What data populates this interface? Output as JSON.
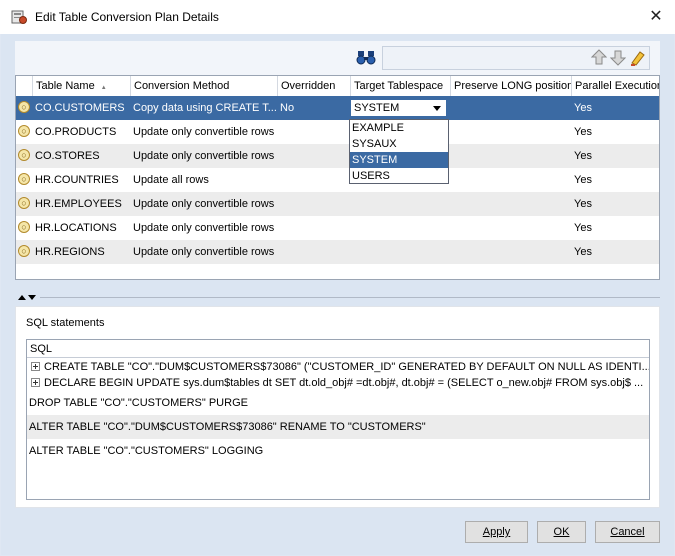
{
  "window": {
    "title": "Edit Table Conversion Plan Details",
    "close_glyph": "✕"
  },
  "toolbar": {
    "find_value": ""
  },
  "grid": {
    "columns": [
      "Table Name",
      "Conversion Method",
      "Overridden",
      "Target Tablespace",
      "Preserve LONG position",
      "Parallel Execution"
    ],
    "sort_glyph": "▲",
    "rows": [
      {
        "table": "CO.CUSTOMERS",
        "method": "Copy data using CREATE T...",
        "overridden": "No",
        "tablespace": "SYSTEM",
        "preserve": "",
        "parallel": "Yes"
      },
      {
        "table": "CO.PRODUCTS",
        "method": "Update only convertible rows",
        "overridden": "",
        "tablespace": "",
        "preserve": "",
        "parallel": "Yes"
      },
      {
        "table": "CO.STORES",
        "method": "Update only convertible rows",
        "overridden": "",
        "tablespace": "",
        "preserve": "",
        "parallel": "Yes"
      },
      {
        "table": "HR.COUNTRIES",
        "method": "Update all rows",
        "overridden": "",
        "tablespace": "",
        "preserve": "",
        "parallel": "Yes"
      },
      {
        "table": "HR.EMPLOYEES",
        "method": "Update only convertible rows",
        "overridden": "",
        "tablespace": "",
        "preserve": "",
        "parallel": "Yes"
      },
      {
        "table": "HR.LOCATIONS",
        "method": "Update only convertible rows",
        "overridden": "",
        "tablespace": "",
        "preserve": "",
        "parallel": "Yes"
      },
      {
        "table": "HR.REGIONS",
        "method": "Update only convertible rows",
        "overridden": "",
        "tablespace": "",
        "preserve": "",
        "parallel": "Yes"
      }
    ],
    "tablespace_options": [
      "EXAMPLE",
      "SYSAUX",
      "SYSTEM",
      "USERS"
    ],
    "selected_tablespace": "SYSTEM"
  },
  "sql": {
    "label": "SQL statements",
    "header": "SQL",
    "statements": [
      "CREATE TABLE \"CO\".\"DUM$CUSTOMERS$73086\"    (\"CUSTOMER_ID\"  GENERATED BY DEFAULT ON NULL AS IDENTI...",
      "DECLARE BEGIN    UPDATE sys.dum$tables dt SET dt.old_obj# =dt.obj#, dt.obj# = (SELECT o_new.obj# FROM sys.obj$ ...",
      "DROP TABLE \"CO\".\"CUSTOMERS\" PURGE",
      "ALTER TABLE \"CO\".\"DUM$CUSTOMERS$73086\" RENAME TO \"CUSTOMERS\"",
      "ALTER TABLE \"CO\".\"CUSTOMERS\" LOGGING"
    ]
  },
  "buttons": {
    "apply": "Apply",
    "ok": "OK",
    "cancel": "Cancel"
  },
  "colors": {
    "selection": "#3b6aa3",
    "background": "#dbe5f2",
    "alt_row": "#ececec"
  }
}
